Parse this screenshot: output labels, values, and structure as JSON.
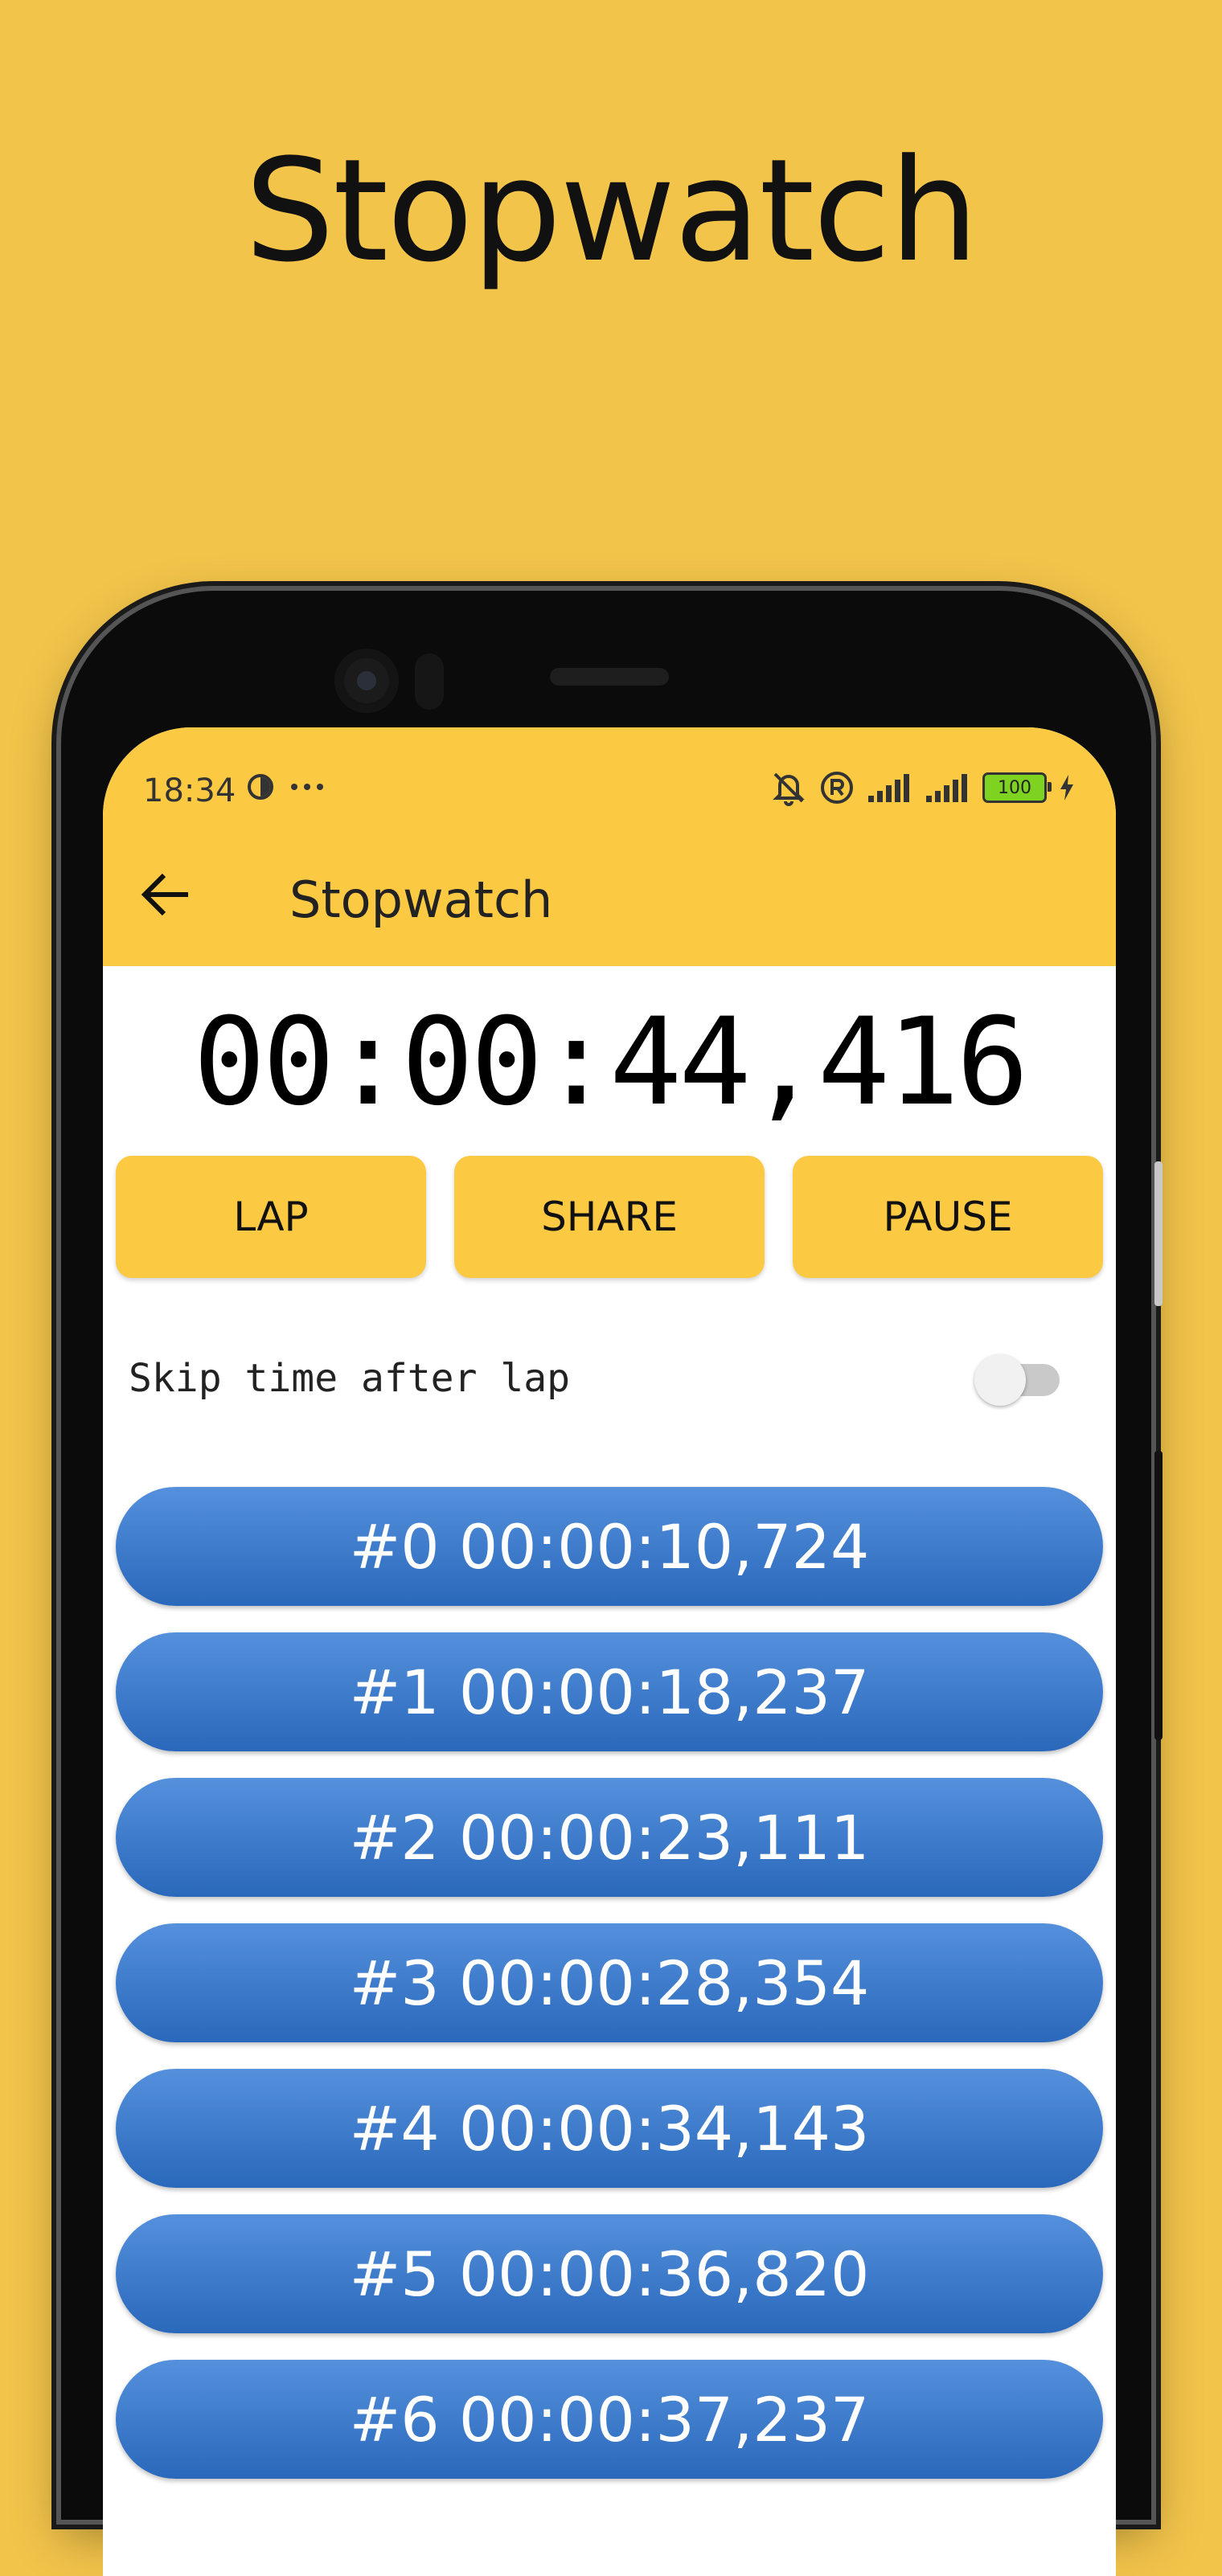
{
  "promo": {
    "title": "Stopwatch"
  },
  "status_bar": {
    "time": "18:34",
    "battery": "100"
  },
  "app_bar": {
    "title": "Stopwatch"
  },
  "timer": {
    "display": "00:00:44,416"
  },
  "buttons": {
    "lap": "LAP",
    "share": "SHARE",
    "pause": "PAUSE"
  },
  "skip_setting": {
    "label": "Skip time after lap",
    "enabled": false
  },
  "laps": [
    "#0 00:00:10,724",
    "#1 00:00:18,237",
    "#2 00:00:23,111",
    "#3 00:00:28,354",
    "#4 00:00:34,143",
    "#5 00:00:36,820",
    "#6 00:00:37,237"
  ],
  "colors": {
    "background": "#F2C44A",
    "accent": "#FCC943",
    "lap_blue": "#3A78CC"
  }
}
